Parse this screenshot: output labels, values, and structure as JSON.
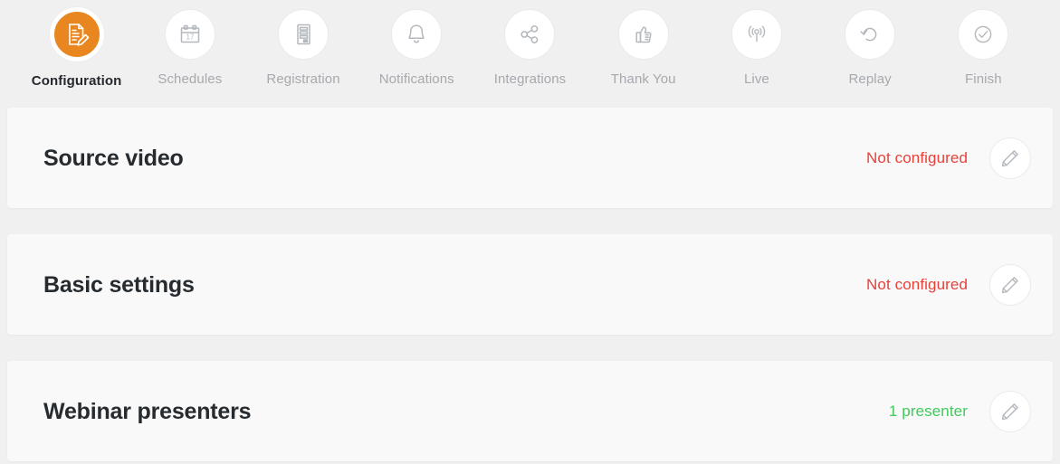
{
  "wizard": {
    "steps": [
      {
        "label": "Configuration",
        "icon": "document-pencil-icon",
        "active": true
      },
      {
        "label": "Schedules",
        "icon": "calendar-icon",
        "active": false
      },
      {
        "label": "Registration",
        "icon": "form-icon",
        "active": false
      },
      {
        "label": "Notifications",
        "icon": "bell-icon",
        "active": false
      },
      {
        "label": "Integrations",
        "icon": "share-nodes-icon",
        "active": false
      },
      {
        "label": "Thank You",
        "icon": "thumbs-up-icon",
        "active": false
      },
      {
        "label": "Live",
        "icon": "broadcast-icon",
        "active": false
      },
      {
        "label": "Replay",
        "icon": "replay-arrow-icon",
        "active": false
      },
      {
        "label": "Finish",
        "icon": "check-circle-icon",
        "active": false
      }
    ]
  },
  "cards": [
    {
      "title": "Source video",
      "status": "Not configured",
      "status_state": "error",
      "edit_icon": "pencil-icon"
    },
    {
      "title": "Basic settings",
      "status": "Not configured",
      "status_state": "error",
      "edit_icon": "pencil-icon"
    },
    {
      "title": "Webinar presenters",
      "status": "1 presenter",
      "status_state": "ok",
      "edit_icon": "pencil-icon"
    }
  ],
  "colors": {
    "accent": "#e8871f",
    "page_background": "#f0f0f0",
    "card_background": "#f9f9f9",
    "status_error": "#e8413a",
    "status_ok": "#3dcb5a",
    "inactive_label": "#a6a9ad",
    "active_label": "#25292e"
  }
}
